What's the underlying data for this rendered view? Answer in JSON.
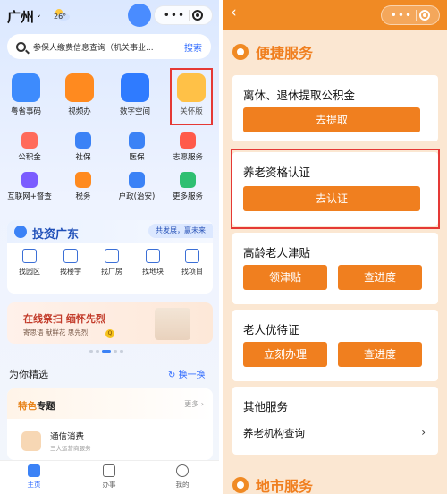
{
  "left": {
    "city": "广州",
    "temperature": "26°",
    "search": {
      "placeholder": "参保人缴费信息查询（机关事业...",
      "button": "搜索"
    },
    "apps": [
      {
        "label": "粤省事码",
        "color": "#3d8bfd"
      },
      {
        "label": "视频办",
        "color": "#ff8a1f"
      },
      {
        "label": "数字空间",
        "color": "#2f7bff"
      },
      {
        "label": "关怀版",
        "color": "#ffb21a"
      }
    ],
    "services": [
      {
        "label": "公积金",
        "color": "#ff6b5b"
      },
      {
        "label": "社保",
        "color": "#3b82f6"
      },
      {
        "label": "医保",
        "color": "#3b82f6"
      },
      {
        "label": "志愿服务",
        "color": "#ff5a4a"
      },
      {
        "label": "互联网+督查",
        "color": "#7b5cff"
      },
      {
        "label": "税务",
        "color": "#ff8a1f"
      },
      {
        "label": "户政(治安)",
        "color": "#3b82f6"
      },
      {
        "label": "更多服务",
        "color": "#2fbf71"
      }
    ],
    "invest": {
      "title": "投资广东",
      "slogan": "共发展，赢未来",
      "items": [
        "找园区",
        "找楼宇",
        "找厂房",
        "找地块",
        "找项目"
      ]
    },
    "banner": {
      "title": "在线祭扫 缅怀先烈",
      "subtitle": "寄思语 献鲜花 思先烈",
      "badge": "Q"
    },
    "picks_title": "为你精选",
    "swap_label": "换一换",
    "feature": {
      "title_highlight": "特色",
      "title_rest": "专题",
      "more": "更多 ›",
      "item_name": "通信消费",
      "item_desc": "三大运营商服务"
    },
    "tabs": [
      {
        "label": "主页",
        "active": true
      },
      {
        "label": "办事",
        "active": false
      },
      {
        "label": "我的",
        "active": false
      }
    ]
  },
  "right": {
    "section_title": "便捷服务",
    "cards": [
      {
        "title": "离休、退休提取公积金",
        "buttons": [
          "去提取"
        ]
      },
      {
        "title": "养老资格认证",
        "buttons": [
          "去认证"
        ]
      },
      {
        "title": "高龄老人津贴",
        "buttons": [
          "领津贴",
          "查进度"
        ]
      },
      {
        "title": "老人优待证",
        "buttons": [
          "立刻办理",
          "查进度"
        ]
      }
    ],
    "other": {
      "title": "其他服务",
      "row": "养老机构查询",
      "chevron": "›"
    },
    "next_section": "地市服务",
    "accent": "#f07f1f"
  }
}
